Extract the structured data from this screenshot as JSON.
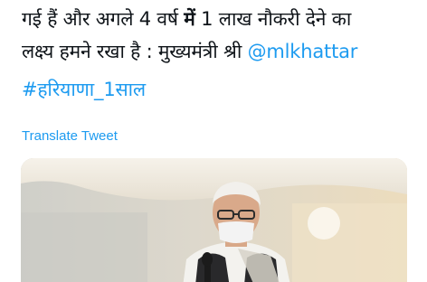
{
  "tweet": {
    "line1": {
      "before": "गई हैं और अगले 4 वर्ष ",
      "bold": "में",
      "after": " 1 लाख नौकरी देने का"
    },
    "line2": {
      "text": "लक्ष्य हमने रखा है : मुख्यमंत्री श्री ",
      "mention": "@mlkhattar"
    },
    "hashtag": "#हरियाणा_1साल"
  },
  "translate_label": "Translate Tweet",
  "media": {
    "icon": "photo",
    "colors": {
      "background_left": "#d3d2cb",
      "background_right": "#eadcc0",
      "tent": "#f2ece2",
      "vest": "#2a2a2c",
      "kurta": "#f4f3ef",
      "mask": "#f1f1f1"
    }
  },
  "colors": {
    "link": "#1d9bf0",
    "text": "#0f1419"
  }
}
